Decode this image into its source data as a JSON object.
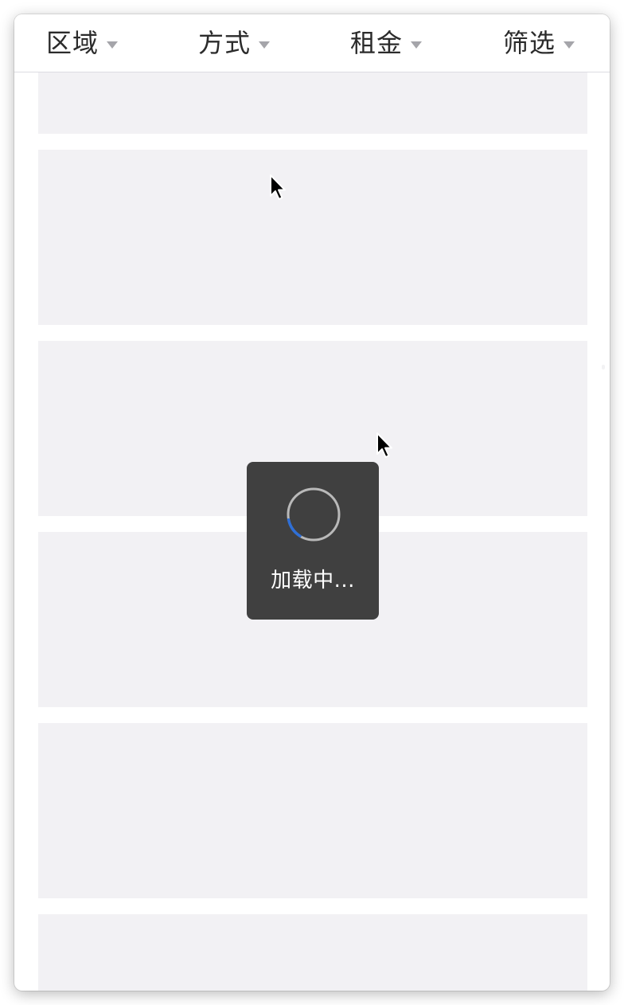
{
  "filters": [
    {
      "label": "区域"
    },
    {
      "label": "方式"
    },
    {
      "label": "租金"
    },
    {
      "label": "筛选"
    }
  ],
  "loading": {
    "text": "加载中..."
  },
  "icons": {
    "caret": "caret-down-icon",
    "spinner": "loading-spinner-icon",
    "cursor": "mouse-pointer-icon"
  },
  "colors": {
    "card_placeholder": "#f2f1f4",
    "toast_background": "#404040",
    "spinner_accent": "#2f6fd6",
    "caret": "#a5a5aa"
  }
}
